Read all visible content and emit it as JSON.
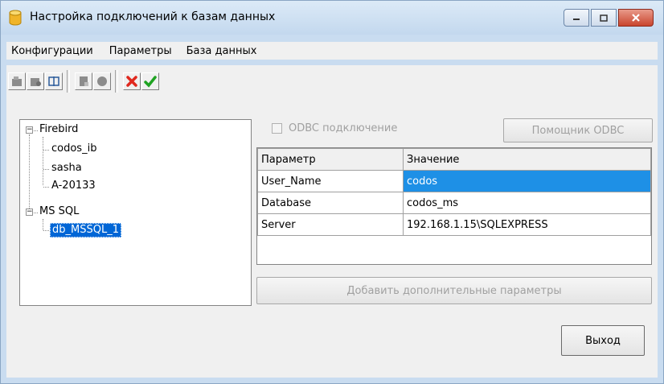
{
  "window": {
    "title": "Настройка подключений к базам данных"
  },
  "menu": [
    "Конфигурации",
    "Параметры",
    "База данных"
  ],
  "toolbar": {
    "buttons": [
      "add-db-icon",
      "db-settings-icon",
      "edit-connection-icon",
      "new-db-icon",
      "disconnect-icon",
      "cancel-icon",
      "apply-icon"
    ]
  },
  "tree": {
    "groups": [
      {
        "label": "Firebird",
        "expander": "−",
        "children": [
          "codos_ib",
          "sasha",
          "A-20133"
        ]
      },
      {
        "label": "MS SQL",
        "expander": "−",
        "children": [
          "db_MSSQL_1"
        ]
      }
    ],
    "selected": "db_MSSQL_1"
  },
  "odbc": {
    "checkbox_label": "ODBC подключение",
    "checked": false,
    "helper_button": "Помощник ODBC"
  },
  "params": {
    "headers": [
      "Параметр",
      "Значение"
    ],
    "rows": [
      [
        "User_Name",
        "codos"
      ],
      [
        "Database",
        "codos_ms"
      ],
      [
        "Server",
        "192.168.1.15\\SQLEXPRESS"
      ]
    ]
  },
  "add_params_button": "Добавить дополнительные параметры",
  "exit_button": "Выход"
}
